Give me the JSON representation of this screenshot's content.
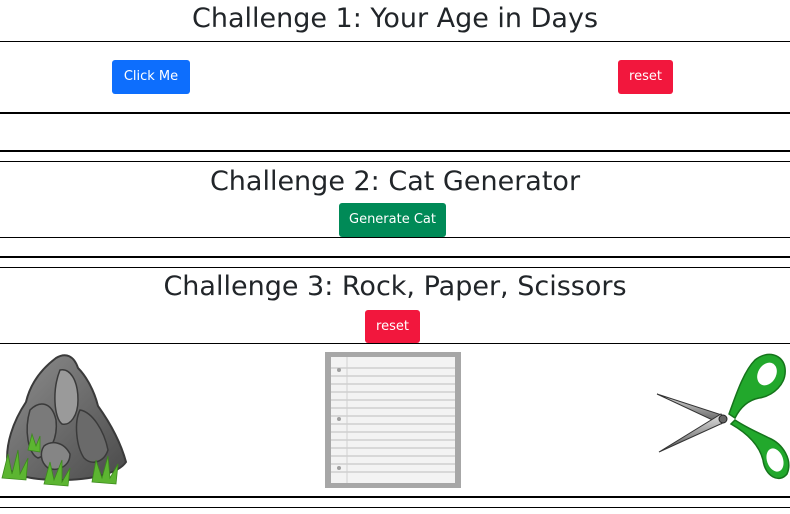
{
  "challenge1": {
    "title": "Challenge 1: Your Age in Days",
    "click_button": "Click Me",
    "reset_button": "reset",
    "colors": {
      "primary": "#0d6efd",
      "danger": "#f2173d"
    }
  },
  "challenge2": {
    "title": "Challenge 2: Cat Generator",
    "generate_button": "Generate Cat",
    "colors": {
      "success": "#008a57"
    }
  },
  "challenge3": {
    "title": "Challenge 3: Rock, Paper, Scissors",
    "reset_button": "reset",
    "choices": [
      {
        "name": "rock",
        "icon": "rock-image"
      },
      {
        "name": "paper",
        "icon": "paper-image"
      },
      {
        "name": "scissors",
        "icon": "scissors-image"
      }
    ],
    "colors": {
      "scissors_handle": "#22a82c"
    }
  }
}
